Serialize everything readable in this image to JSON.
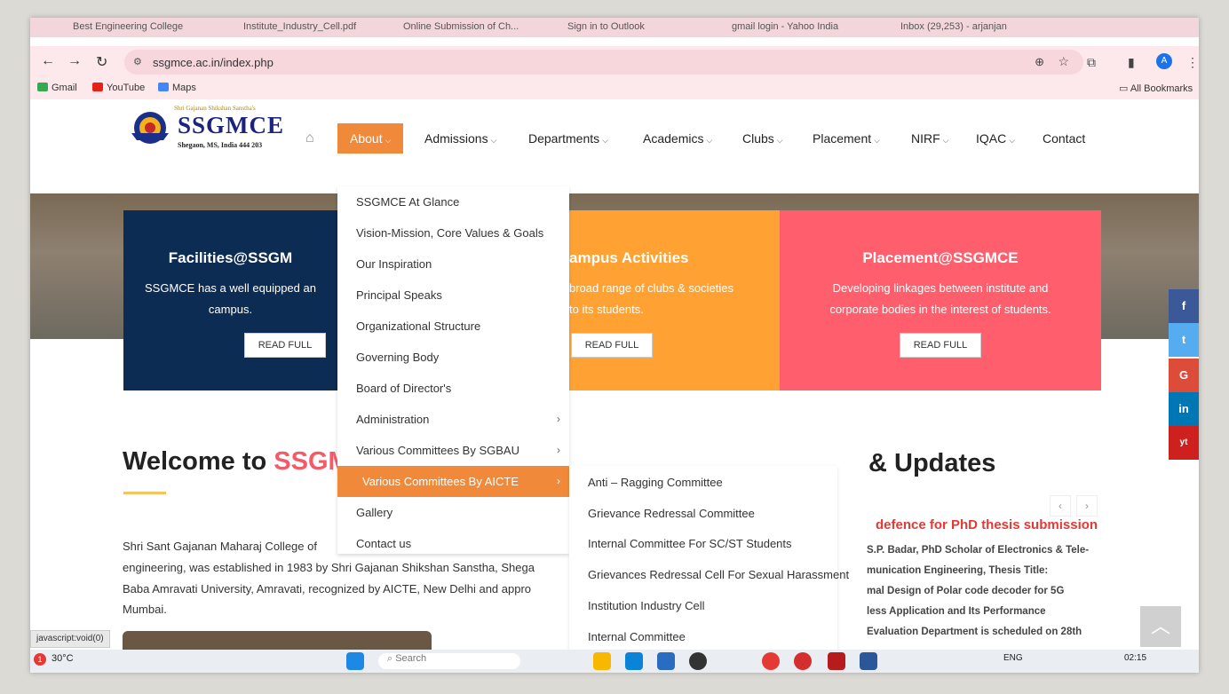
{
  "browser": {
    "tabs": [
      "Best Engineering College",
      "Institute_Industry_Cell.pdf",
      "Online Submission of Ch...",
      "Sign in to Outlook",
      "gmail login - Yahoo India",
      "Inbox (29,253) - arjanjan"
    ],
    "url": "ssgmce.ac.in/index.php",
    "bookmarks": [
      "Gmail",
      "YouTube",
      "Maps"
    ],
    "all_bookmarks": "All Bookmarks",
    "profile_initial": "A"
  },
  "logo": {
    "tagline": "Shri Gajanan Shikshan Sanstha's",
    "name": "SSGMCE",
    "address": "Shegaon, MS, India 444 203"
  },
  "nav": {
    "about": "About",
    "admissions": "Admissions",
    "departments": "Departments",
    "academics": "Academics",
    "clubs": "Clubs",
    "placement": "Placement",
    "nirf": "NIRF",
    "iqac": "IQAC",
    "contact": "Contact"
  },
  "about_menu": [
    "SSGMCE At Glance",
    "Vision-Mission, Core Values & Goals",
    "Our Inspiration",
    "Principal Speaks",
    "Organizational Structure",
    "Governing Body",
    "Board of Director's",
    "Administration",
    "Various Committees By SGBAU",
    "Various Committees By AICTE",
    "Gallery",
    "Contact us"
  ],
  "aicte_submenu": [
    "Anti – Ragging Committee",
    "Grievance Redressal Committee",
    "Internal Committee For SC/ST Students",
    "Grievances Redressal Cell For Sexual Harassment",
    "Institution Industry Cell",
    "Internal Committee"
  ],
  "cards": {
    "facilities": {
      "title": "Facilities@SSGM",
      "text1": "SSGMCE has a well equipped an",
      "text2": "campus.",
      "button": "READ FULL"
    },
    "campus": {
      "title": "ampus Activities",
      "text1": "broad range of clubs & societies",
      "text2": "to its students.",
      "button": "READ FULL"
    },
    "placement": {
      "title": "Placement@SSGMCE",
      "text1": "Developing linkages between institute and",
      "text2": "corporate bodies in the interest of students.",
      "button": "READ FULL"
    }
  },
  "welcome": {
    "prefix": "Welcome to ",
    "highlight": "SSGM",
    "lines": [
      "Shri Sant Gajanan Maharaj College of",
      "engineering, was established in 1983 by Shri Gajanan Shikshan Sanstha, Shega",
      "Baba Amravati University, Amravati, recognized by AICTE, New Delhi and appro",
      "Mumbai."
    ]
  },
  "updates": {
    "heading": "& Updates",
    "prev": "‹",
    "next": "›",
    "news_title": "defence for PhD thesis submission",
    "news_lines": [
      "S.P. Badar, PhD Scholar of Electronics & Tele-",
      "munication Engineering, Thesis Title:",
      "mal Design of Polar code decoder for 5G",
      "less Application and Its Performance",
      "Evaluation Department is scheduled on 28th"
    ]
  },
  "social": [
    "f",
    "t",
    "G",
    "in",
    "yt"
  ],
  "status_text": "javascript:void(0)",
  "taskbar": {
    "weather": "30°C",
    "badge": "1",
    "search": "Search",
    "lang": "ENG",
    "time": "02:15"
  },
  "colors": {
    "accent": "#f08a3a",
    "navy": "#0d2c54",
    "orange": "#ffa233",
    "pink": "#ff5f6d",
    "headline_red": "#e53935"
  }
}
